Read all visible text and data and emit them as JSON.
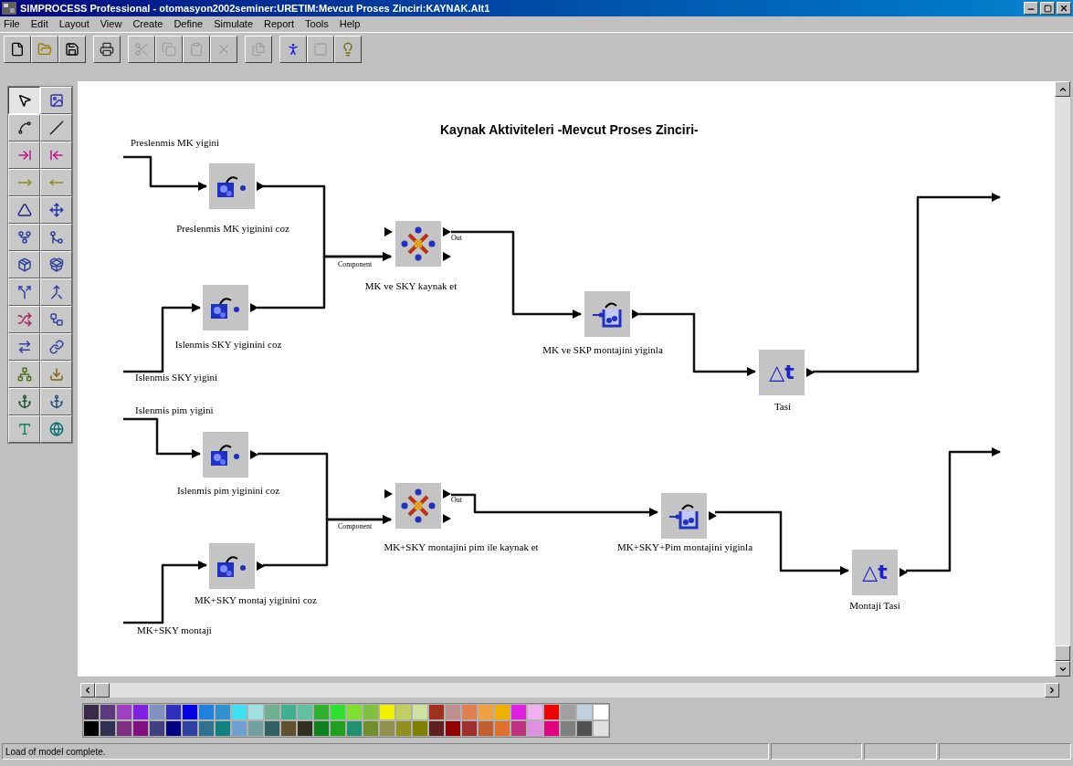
{
  "window": {
    "title": "SIMPROCESS Professional - otomasyon2002seminer:URETIM:Mevcut Proses Zinciri:KAYNAK.Alt1"
  },
  "menu": [
    "File",
    "Edit",
    "Layout",
    "View",
    "Create",
    "Define",
    "Simulate",
    "Report",
    "Tools",
    "Help"
  ],
  "toolbar": [
    {
      "kind": "new",
      "disabled": false
    },
    {
      "kind": "open",
      "disabled": false
    },
    {
      "kind": "save",
      "disabled": false
    },
    {
      "kind": "print",
      "disabled": false
    },
    {
      "kind": "cut",
      "disabled": true
    },
    {
      "kind": "copy",
      "disabled": true
    },
    {
      "kind": "paste",
      "disabled": true
    },
    {
      "kind": "delete",
      "disabled": true
    },
    {
      "kind": "properties",
      "disabled": true
    },
    {
      "kind": "run",
      "disabled": false
    },
    {
      "kind": "stop",
      "disabled": true
    },
    {
      "kind": "help",
      "disabled": false
    }
  ],
  "tools": [
    {
      "kind": "pointer",
      "selected": true
    },
    {
      "kind": "picture",
      "selected": false
    },
    {
      "kind": "curve",
      "selected": false
    },
    {
      "kind": "line",
      "selected": false
    },
    {
      "kind": "pad-in",
      "selected": false
    },
    {
      "kind": "pad-out",
      "selected": false
    },
    {
      "kind": "bar-in",
      "selected": false
    },
    {
      "kind": "bar-out",
      "selected": false
    },
    {
      "kind": "delay",
      "selected": false
    },
    {
      "kind": "move",
      "selected": false
    },
    {
      "kind": "branch",
      "selected": false
    },
    {
      "kind": "merge",
      "selected": false
    },
    {
      "kind": "batch",
      "selected": false
    },
    {
      "kind": "unbatch",
      "selected": false
    },
    {
      "kind": "split",
      "selected": false
    },
    {
      "kind": "join",
      "selected": false
    },
    {
      "kind": "transform",
      "selected": false
    },
    {
      "kind": "assign",
      "selected": false
    },
    {
      "kind": "gate",
      "selected": false
    },
    {
      "kind": "link",
      "selected": false
    },
    {
      "kind": "sync",
      "selected": false
    },
    {
      "kind": "resource",
      "selected": false
    },
    {
      "kind": "get",
      "selected": false
    },
    {
      "kind": "free",
      "selected": false
    },
    {
      "kind": "text",
      "selected": false
    },
    {
      "kind": "globe",
      "selected": false
    }
  ],
  "diagram": {
    "title": "Kaynak Aktiviteleri  -Mevcut Proses Zinciri-",
    "sources": [
      "Preslenmis MK yigini",
      "Islenmis SKY yigini",
      "Islenmis pim yigini",
      "MK+SKY montaji"
    ],
    "nodes": [
      {
        "kind": "unbatch",
        "label": "Preslenmis MK yiginini coz"
      },
      {
        "kind": "unbatch",
        "label": "Islenmis SKY yiginini coz"
      },
      {
        "kind": "assemble",
        "label": "MK ve SKY kaynak et",
        "in_label": "Component",
        "out_label": "Out"
      },
      {
        "kind": "batch",
        "label": "MK ve SKP montajini yiginla"
      },
      {
        "kind": "delay",
        "label": "Tasi",
        "glyph": "△t"
      },
      {
        "kind": "unbatch",
        "label": "Islenmis pim yiginini coz"
      },
      {
        "kind": "unbatch",
        "label": "MK+SKY montaj yiginini coz"
      },
      {
        "kind": "assemble",
        "label": "MK+SKY montajini pim ile kaynak et",
        "in_label": "Component",
        "out_label": "Out"
      },
      {
        "kind": "batch",
        "label": "MK+SKY+Pim montajini yiginla"
      },
      {
        "kind": "delay",
        "label": "Montaji Tasi",
        "glyph": "△t"
      }
    ]
  },
  "palette": [
    {
      "color": "#3a2a4a"
    },
    {
      "color": "#5a3a7a"
    },
    {
      "color": "#a040c0"
    },
    {
      "color": "#8020e0"
    },
    {
      "color": "#8090c0"
    },
    {
      "color": "#3030c0"
    },
    {
      "color": "#0000e0"
    },
    {
      "color": "#2080e0"
    },
    {
      "color": "#3090d0"
    },
    {
      "color": "#40e0f0"
    },
    {
      "color": "#a0e0e0"
    },
    {
      "color": "#70b090"
    },
    {
      "color": "#40b090"
    },
    {
      "color": "#60c0a0"
    },
    {
      "color": "#30b030"
    },
    {
      "color": "#30e030"
    },
    {
      "color": "#80e030"
    },
    {
      "color": "#80c040"
    },
    {
      "color": "#f0f000"
    },
    {
      "color": "#c0d060"
    },
    {
      "color": "#d0e0a0"
    },
    {
      "color": "#a03020"
    },
    {
      "color": "#c09090"
    },
    {
      "color": "#e08050"
    },
    {
      "color": "#f0a040"
    },
    {
      "color": "#f0b000"
    },
    {
      "color": "#e020e0"
    },
    {
      "color": "#f0b0f0"
    },
    {
      "color": "#f00000"
    },
    {
      "color": "#a0a0a0"
    },
    {
      "color": "#c0d0e0"
    },
    {
      "color": "#ffffff"
    },
    {
      "color": "#000000"
    },
    {
      "color": "#303050"
    },
    {
      "color": "#803080"
    },
    {
      "color": "#801080"
    },
    {
      "color": "#404080"
    },
    {
      "color": "#000080"
    },
    {
      "color": "#3040a0"
    },
    {
      "color": "#307090"
    },
    {
      "color": "#108080"
    },
    {
      "color": "#70a0d0"
    },
    {
      "color": "#70a0a0"
    },
    {
      "color": "#306060"
    },
    {
      "color": "#605030"
    },
    {
      "color": "#303020"
    },
    {
      "color": "#108020"
    },
    {
      "color": "#20a020"
    },
    {
      "color": "#209070"
    },
    {
      "color": "#709030"
    },
    {
      "color": "#909050"
    },
    {
      "color": "#909020"
    },
    {
      "color": "#808000"
    },
    {
      "color": "#602020"
    },
    {
      "color": "#900000"
    },
    {
      "color": "#a03030"
    },
    {
      "color": "#c06030"
    },
    {
      "color": "#e07030"
    },
    {
      "color": "#c03080"
    },
    {
      "color": "#e090e0"
    },
    {
      "color": "#e00080"
    },
    {
      "color": "#808080"
    },
    {
      "color": "#505050"
    },
    {
      "color": "#e0e0e0"
    }
  ],
  "status_bar": "Load of model complete."
}
